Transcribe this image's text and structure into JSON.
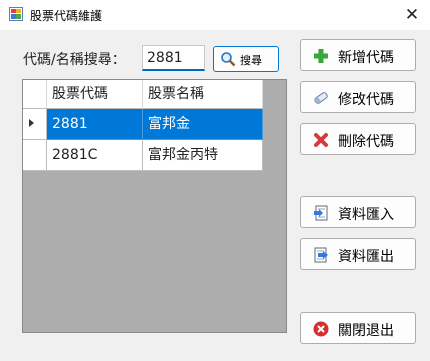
{
  "window": {
    "title": "股票代碼維護",
    "app_icon": "app-window-icon",
    "close_symbol": "✕"
  },
  "search": {
    "label": "代碼/名稱搜尋：",
    "value": "2881",
    "button_label": "搜尋",
    "button_icon": "magnifier-icon"
  },
  "grid": {
    "columns": [
      "股票代碼",
      "股票名稱"
    ],
    "rows": [
      {
        "code": "2881",
        "name": "富邦金",
        "selected": true
      },
      {
        "code": "2881C",
        "name": "富邦金丙特",
        "selected": false
      }
    ]
  },
  "buttons": {
    "add": {
      "label": "新增代碼",
      "icon": "plus-icon"
    },
    "edit": {
      "label": "修改代碼",
      "icon": "eraser-icon"
    },
    "delete": {
      "label": "刪除代碼",
      "icon": "x-icon"
    },
    "import": {
      "label": "資料匯入",
      "icon": "import-icon"
    },
    "export": {
      "label": "資料匯出",
      "icon": "export-icon"
    },
    "exit": {
      "label": "關閉退出",
      "icon": "close-circle-icon"
    }
  },
  "colors": {
    "selection": "#0078d7",
    "grid_background": "#adadad",
    "add_green": "#3aa53a",
    "delete_red": "#d23c3c"
  }
}
